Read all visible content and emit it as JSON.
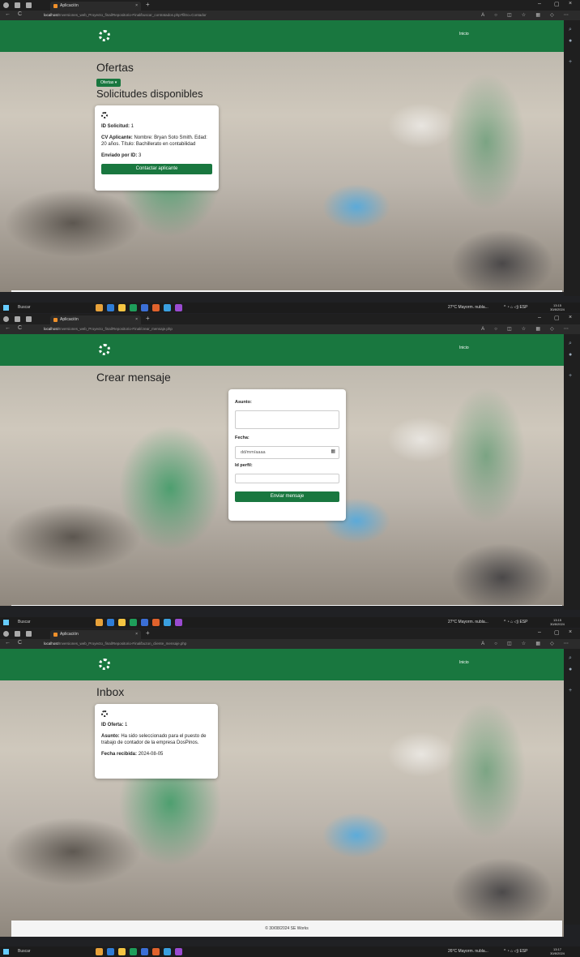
{
  "browser": {
    "tab_title": "Aplicación",
    "tab_close": "×",
    "new_tab": "+",
    "win_min": "–",
    "win_max": "▢",
    "win_close": "×",
    "nav_back": "←",
    "nav_refresh": "C",
    "url_host": "localhost",
    "urls": [
      "/Inversiones_web_Proyecto_final/Repositorio-Final/buscar_contratados.php?filtro=Contador",
      "/Inversiones_web_Proyecto_final/Repositorio-Final/crear_mensaje.php",
      "/Inversiones_web_Proyecto_final/Repositorio-Final/buzon_cliente_mensaje.php"
    ]
  },
  "app": {
    "nav_link": "Inicio",
    "footer": "© 30/08/2024 SE Works"
  },
  "screen1": {
    "title": "Ofertas",
    "dropdown_label": "Ofertas ▾",
    "subtitle": "Solicitudes disponibles",
    "card": {
      "id_label": "ID Solicitud:",
      "id_value": "1",
      "cv_label": "CV Aplicante:",
      "cv_value": "Nombre: Bryan Soto Smith. Edad: 20 años. Título: Bachillerato en contabilidad",
      "sent_label": "Enviado por ID:",
      "sent_value": "3",
      "button": "Contactar aplicante"
    }
  },
  "screen2": {
    "title": "Crear mensaje",
    "form": {
      "subject_label": "Asunto:",
      "date_label": "Fecha:",
      "date_value": "dd/mm/aaaa",
      "profile_label": "Id perfil:",
      "submit": "Enviar mensaje"
    }
  },
  "screen3": {
    "title": "Inbox",
    "card": {
      "id_label": "ID Oferta:",
      "id_value": "1",
      "subject_label": "Asunto:",
      "subject_value": "Ha sido seleccionado para el puesto de trabajo de contador de la empresa DosPinos.",
      "date_label": "Fecha recibida:",
      "date_value": "2024-08-05"
    }
  },
  "taskbars": [
    {
      "search": "Buscar",
      "weather": "27°C Mayorm. nubla...",
      "time": "13:15",
      "date": "30/8/2024"
    },
    {
      "search": "Buscar",
      "weather": "27°C Mayorm. nubla...",
      "time": "13:15",
      "date": "30/8/2024"
    },
    {
      "search": "Buscar",
      "weather": "26°C Mayorm. nubla...",
      "time": "13:17",
      "date": "30/8/2024"
    }
  ],
  "icons": {
    "tab_favicon": "orange-app-icon",
    "logo": "recycle-gear-logo",
    "calendar": "calendar-icon",
    "start": "windows-start-icon"
  }
}
